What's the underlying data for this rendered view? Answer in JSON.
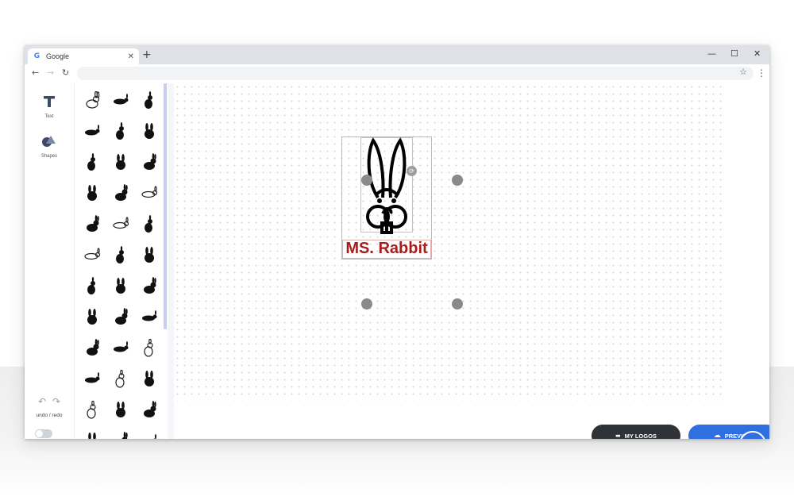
{
  "browser": {
    "tab_title": "Google",
    "tab_favicon": "G",
    "tab_close": "✕",
    "new_tab": "+",
    "window_controls": {
      "minimize": "—",
      "maximize": "☐",
      "close": "✕"
    },
    "nav": {
      "back": "←",
      "forward": "→",
      "reload": "↻"
    },
    "bookmark_icon": "☆",
    "menu_icon": "⋮"
  },
  "tools": {
    "text_label": "Text",
    "shapes_label": "Shapes",
    "undo_icon": "↶",
    "redo_icon": "↷",
    "undo_redo_label": "undo / redo"
  },
  "icon_grid": {
    "icon_names": [
      "rabbit-icon",
      "rabbit-icon",
      "rabbit-icon"
    ],
    "rows": 13,
    "columns": 3
  },
  "canvas": {
    "logo_text": "MS. Rabbit",
    "logo_text_color": "#a51d1d",
    "rotate_icon": "⟳"
  },
  "actions": {
    "my_logos_icon": "▬",
    "my_logos_label": "MY LOGOS",
    "preview_icon": "☁",
    "preview_label": "PREVIEW"
  },
  "colors": {
    "accent": "#2f6fe0",
    "dark_button": "#2f3338"
  }
}
